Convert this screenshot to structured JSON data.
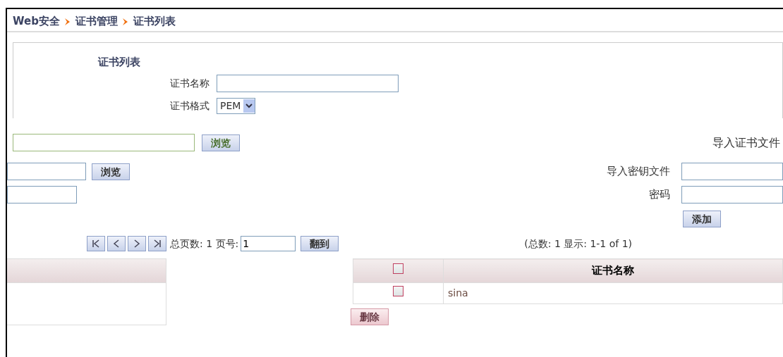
{
  "breadcrumb": [
    {
      "label": "Web安全"
    },
    {
      "label": "证书管理"
    },
    {
      "label": "证书列表"
    }
  ],
  "form": {
    "title": "证书列表",
    "name_label": "证书名称",
    "format_label": "证书格式",
    "format_value": "PEM"
  },
  "import": {
    "cert_label": "导入证书文件",
    "browse_buttons": [
      "浏览",
      "浏览"
    ],
    "key_label": "导入密钥文件",
    "password_label": "密码",
    "add_button": "添加"
  },
  "pager": {
    "pages_text": "总页数: 1 页号:",
    "page_value": "1",
    "go_button": "翻到",
    "summary": "(总数: 1 显示: 1-1 of 1)"
  },
  "table": {
    "header_checked": false,
    "columns": [
      "证书名称"
    ],
    "rows": [
      {
        "checked": false,
        "name": "sina"
      }
    ]
  },
  "delete_button": "删除"
}
